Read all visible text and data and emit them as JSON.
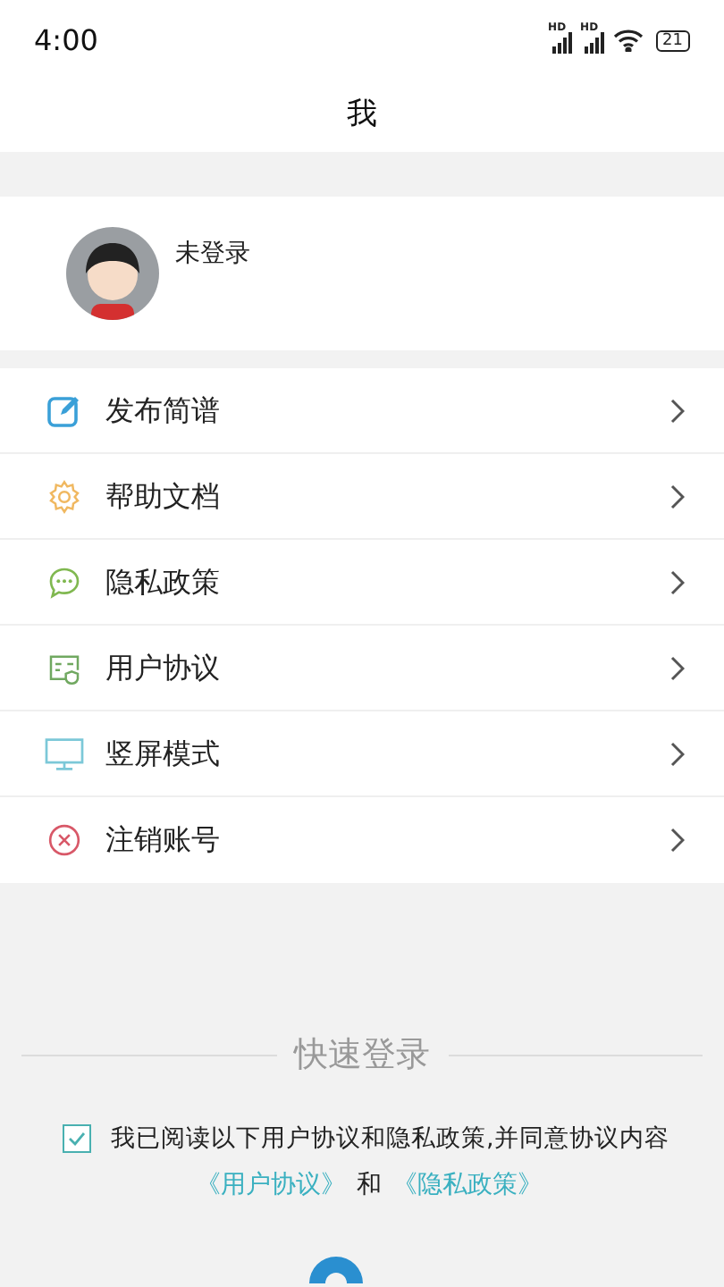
{
  "status_bar": {
    "time": "4:00",
    "signal_label_1": "HD",
    "signal_label_2": "HD",
    "battery": "21"
  },
  "header": {
    "title": "我"
  },
  "profile": {
    "name": "未登录"
  },
  "menu": [
    {
      "kind": "edit",
      "label": "发布简谱"
    },
    {
      "kind": "gear",
      "label": "帮助文档"
    },
    {
      "kind": "chat",
      "label": "隐私政策"
    },
    {
      "kind": "card",
      "label": "用户协议"
    },
    {
      "kind": "monitor",
      "label": "竖屏模式"
    },
    {
      "kind": "cancel",
      "label": "注销账号"
    }
  ],
  "quick_login": {
    "title": "快速登录",
    "agree_checked": true,
    "agree_text": "我已阅读以下用户协议和隐私政策,并同意协议内容",
    "link_1": "《用户协议》",
    "conjunction": "和",
    "link_2": "《隐私政策》"
  }
}
